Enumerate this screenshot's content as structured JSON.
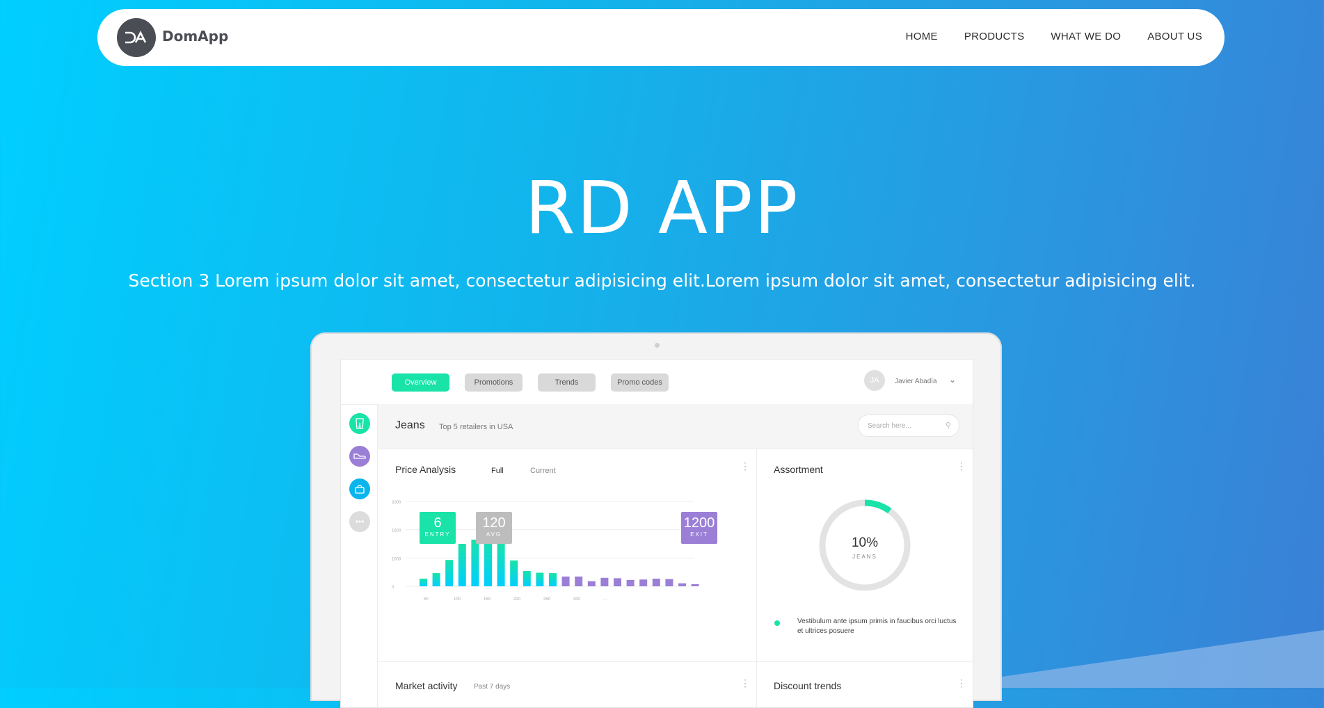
{
  "brand": {
    "name": "DomApp",
    "logo_mark": "DA"
  },
  "nav": {
    "items": [
      "HOME",
      "PRODUCTS",
      "WHAT WE DO",
      "ABOUT US"
    ]
  },
  "hero": {
    "title": "RD APP",
    "subtitle": "Section 3 Lorem ipsum dolor sit amet, consectetur adipisicing elit.Lorem ipsum dolor sit amet, consectetur adipisicing elit."
  },
  "dashboard": {
    "tabs": [
      "Overview",
      "Promotions",
      "Trends",
      "Promo codes"
    ],
    "active_tab": "Overview",
    "user": {
      "initials": "JA",
      "name": "Javier Abadía"
    },
    "sidebar_icons": [
      {
        "name": "jeans-icon",
        "color": "#19e3a8"
      },
      {
        "name": "shoe-icon",
        "color": "#9b7fd6"
      },
      {
        "name": "bag-icon",
        "color": "#0ab5ec"
      },
      {
        "name": "more-icon",
        "color": "#dcdcdc"
      }
    ],
    "category": {
      "title": "Jeans",
      "subtitle": "Top 5 retailers in USA"
    },
    "search_placeholder": "Search here...",
    "price_analysis": {
      "title": "Price Analysis",
      "toggle_full": "Full",
      "toggle_current": "Current",
      "badges": [
        {
          "value": "6",
          "label": "ENTRY",
          "color": "#19e3a8"
        },
        {
          "value": "120",
          "label": "AVG",
          "color": "#bdbdbd"
        },
        {
          "value": "1200",
          "label": "EXIT",
          "color": "#9b7fd6"
        }
      ]
    },
    "assortment": {
      "title": "Assortment",
      "percent_label": "10%",
      "percent_value": 10,
      "ring_label": "JEANS",
      "legend_text": "Vestibulum ante ipsum primis in faucibus orci luctus et ultrices posuere"
    },
    "market_activity": {
      "title": "Market activity",
      "subtitle": "Past 7 days"
    },
    "discount_trends": {
      "title": "Discount trends"
    }
  },
  "chart_data": {
    "type": "bar",
    "y_ticks": [
      "2000",
      "1500",
      "1000",
      "0"
    ],
    "x_ticks": [
      "50",
      "100",
      "150",
      "200",
      "250",
      "300",
      "..."
    ],
    "ylim": [
      0,
      2000
    ],
    "values": [
      180,
      310,
      620,
      1000,
      1100,
      1200,
      1040,
      610,
      360,
      320,
      310,
      230,
      230,
      120,
      200,
      190,
      150,
      160,
      180,
      170,
      70,
      50
    ],
    "colors": {
      "primary": "#19e3a8",
      "secondary": "#00cfff",
      "tail": "#9b7fd6"
    },
    "teal_count": 11
  }
}
